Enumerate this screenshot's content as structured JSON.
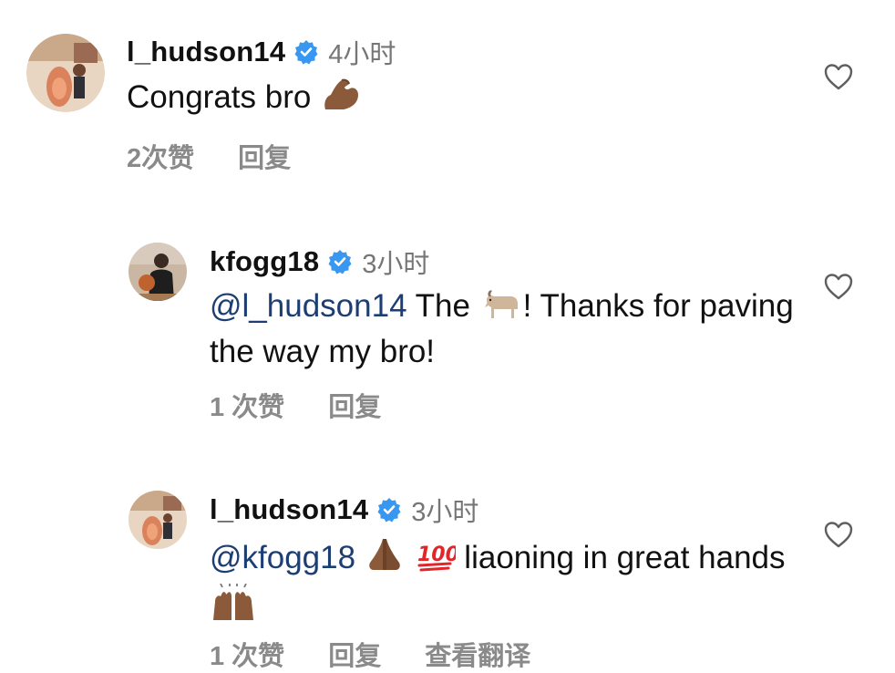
{
  "comments": [
    {
      "username": "l_hudson14",
      "time": "4小时",
      "mention": "",
      "text": "Congrats bro",
      "text2": "",
      "likes": "2次赞",
      "reply": "回复",
      "translate": "",
      "emoji": [
        "flexed-biceps"
      ]
    },
    {
      "username": "kfogg18",
      "time": "3小时",
      "mention": "@l_hudson14",
      "text": " The ",
      "text2": "! Thanks for paving the way my bro!",
      "likes": "1 次赞",
      "reply": "回复",
      "translate": "",
      "emoji": [
        "goat"
      ]
    },
    {
      "username": "l_hudson14",
      "time": "3小时",
      "mention": "@kfogg18",
      "text": "liaoning in great hands",
      "text2": "",
      "likes": "1 次赞",
      "reply": "回复",
      "translate": "查看翻译",
      "emoji": [
        "folded-hands",
        "hundred-points",
        "raising-hands"
      ]
    }
  ],
  "colors": {
    "verified": "#3897f0",
    "mention": "#1c3e72",
    "meta": "#8a8a8a"
  }
}
